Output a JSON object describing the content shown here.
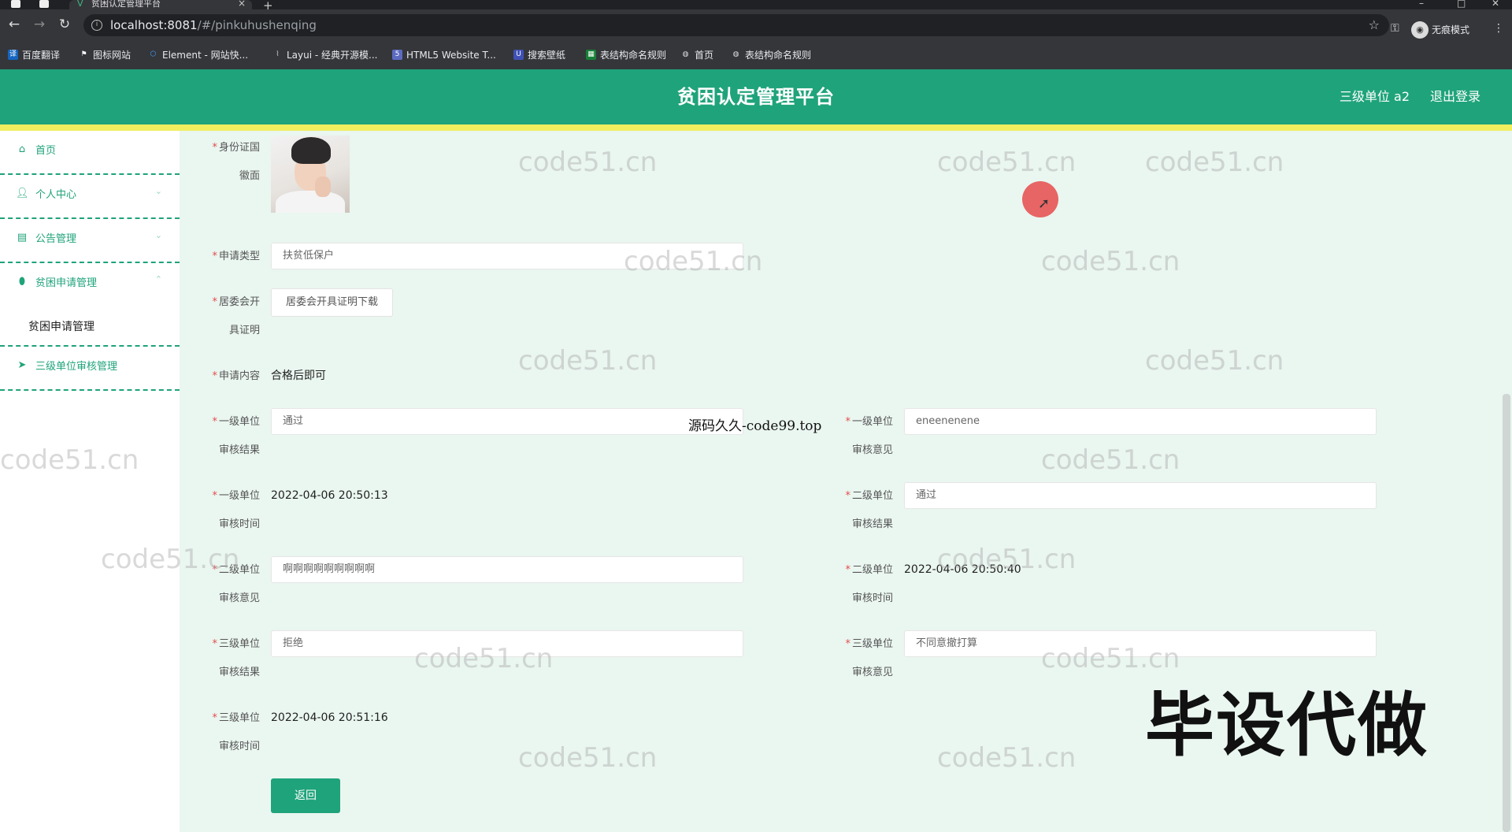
{
  "browser": {
    "tab_title": "贫困认定管理平台",
    "url_host": "localhost:8081",
    "url_path": "/#/pinkuhushenqing",
    "incognito_label": "无痕模式",
    "bookmarks": [
      {
        "label": "百度翻译",
        "icon": "translate-icon",
        "color": "#1565c0"
      },
      {
        "label": "图标网站",
        "icon": "flag-icon",
        "color": "#444444"
      },
      {
        "label": "Element - 网站快...",
        "icon": "element-icon",
        "color": "#409eff"
      },
      {
        "label": "Layui - 经典开源模...",
        "icon": "layui-icon",
        "color": "#555555"
      },
      {
        "label": "HTML5 Website T...",
        "icon": "html5-icon",
        "color": "#5c6bc0"
      },
      {
        "label": "搜索壁纸",
        "icon": "wallpaper-icon",
        "color": "#3f51b5"
      },
      {
        "label": "表结构命名规则",
        "icon": "sheet-icon",
        "color": "#188038"
      },
      {
        "label": "首页",
        "icon": "globe-icon",
        "color": "#555555"
      },
      {
        "label": "表结构命名规则",
        "icon": "globe-icon",
        "color": "#555555"
      }
    ]
  },
  "header": {
    "title": "贫困认定管理平台",
    "user": "三级单位 a2",
    "logout": "退出登录"
  },
  "sidebar": {
    "items": [
      {
        "label": "首页",
        "icon": "home-icon",
        "has_chevron": false
      },
      {
        "label": "个人中心",
        "icon": "user-icon",
        "has_chevron": true
      },
      {
        "label": "公告管理",
        "icon": "notice-icon",
        "has_chevron": true
      },
      {
        "label": "贫困申请管理",
        "icon": "location-icon",
        "has_chevron": true
      }
    ],
    "sub_item": "贫困申请管理",
    "last_item": {
      "label": "三级单位审核管理",
      "icon": "send-icon"
    }
  },
  "form": {
    "id_back_label": [
      "身份证国",
      "徽面"
    ],
    "apply_type_label": "申请类型",
    "apply_type_value": "扶贫低保户",
    "cert_label": [
      "居委会开",
      "具证明"
    ],
    "cert_button": "居委会开具证明下载",
    "content_label": "申请内容",
    "content_value": "合格后即可",
    "l1_result_label": [
      "一级单位",
      "审核结果"
    ],
    "l1_result_value": "通过",
    "l1_opinion_label": [
      "一级单位",
      "审核意见"
    ],
    "l1_opinion_value": "eneenenene",
    "l1_time_label": [
      "一级单位",
      "审核时间"
    ],
    "l1_time_value": "2022-04-06 20:50:13",
    "l2_result_label": [
      "二级单位",
      "审核结果"
    ],
    "l2_result_value": "通过",
    "l2_opinion_label": [
      "二级单位",
      "审核意见"
    ],
    "l2_opinion_value": "啊啊啊啊啊啊啊啊啊",
    "l2_time_label": [
      "二级单位",
      "审核时间"
    ],
    "l2_time_value": "2022-04-06 20:50:40",
    "l3_result_label": [
      "三级单位",
      "审核结果"
    ],
    "l3_result_value": "拒绝",
    "l3_opinion_label": [
      "三级单位",
      "审核意见"
    ],
    "l3_opinion_value": "不同意撤打算",
    "l3_time_label": [
      "三级单位",
      "审核时间"
    ],
    "l3_time_value": "2022-04-06 20:51:16",
    "back_button": "返回"
  },
  "overlays": {
    "watermark_text": "code51.cn",
    "code99_text": "源码久久-code99.top",
    "badge_text": "毕设代做"
  },
  "colors": {
    "primary": "#1fa37a",
    "accent_strip": "#f0ee5e",
    "required": "#e34d4d"
  }
}
